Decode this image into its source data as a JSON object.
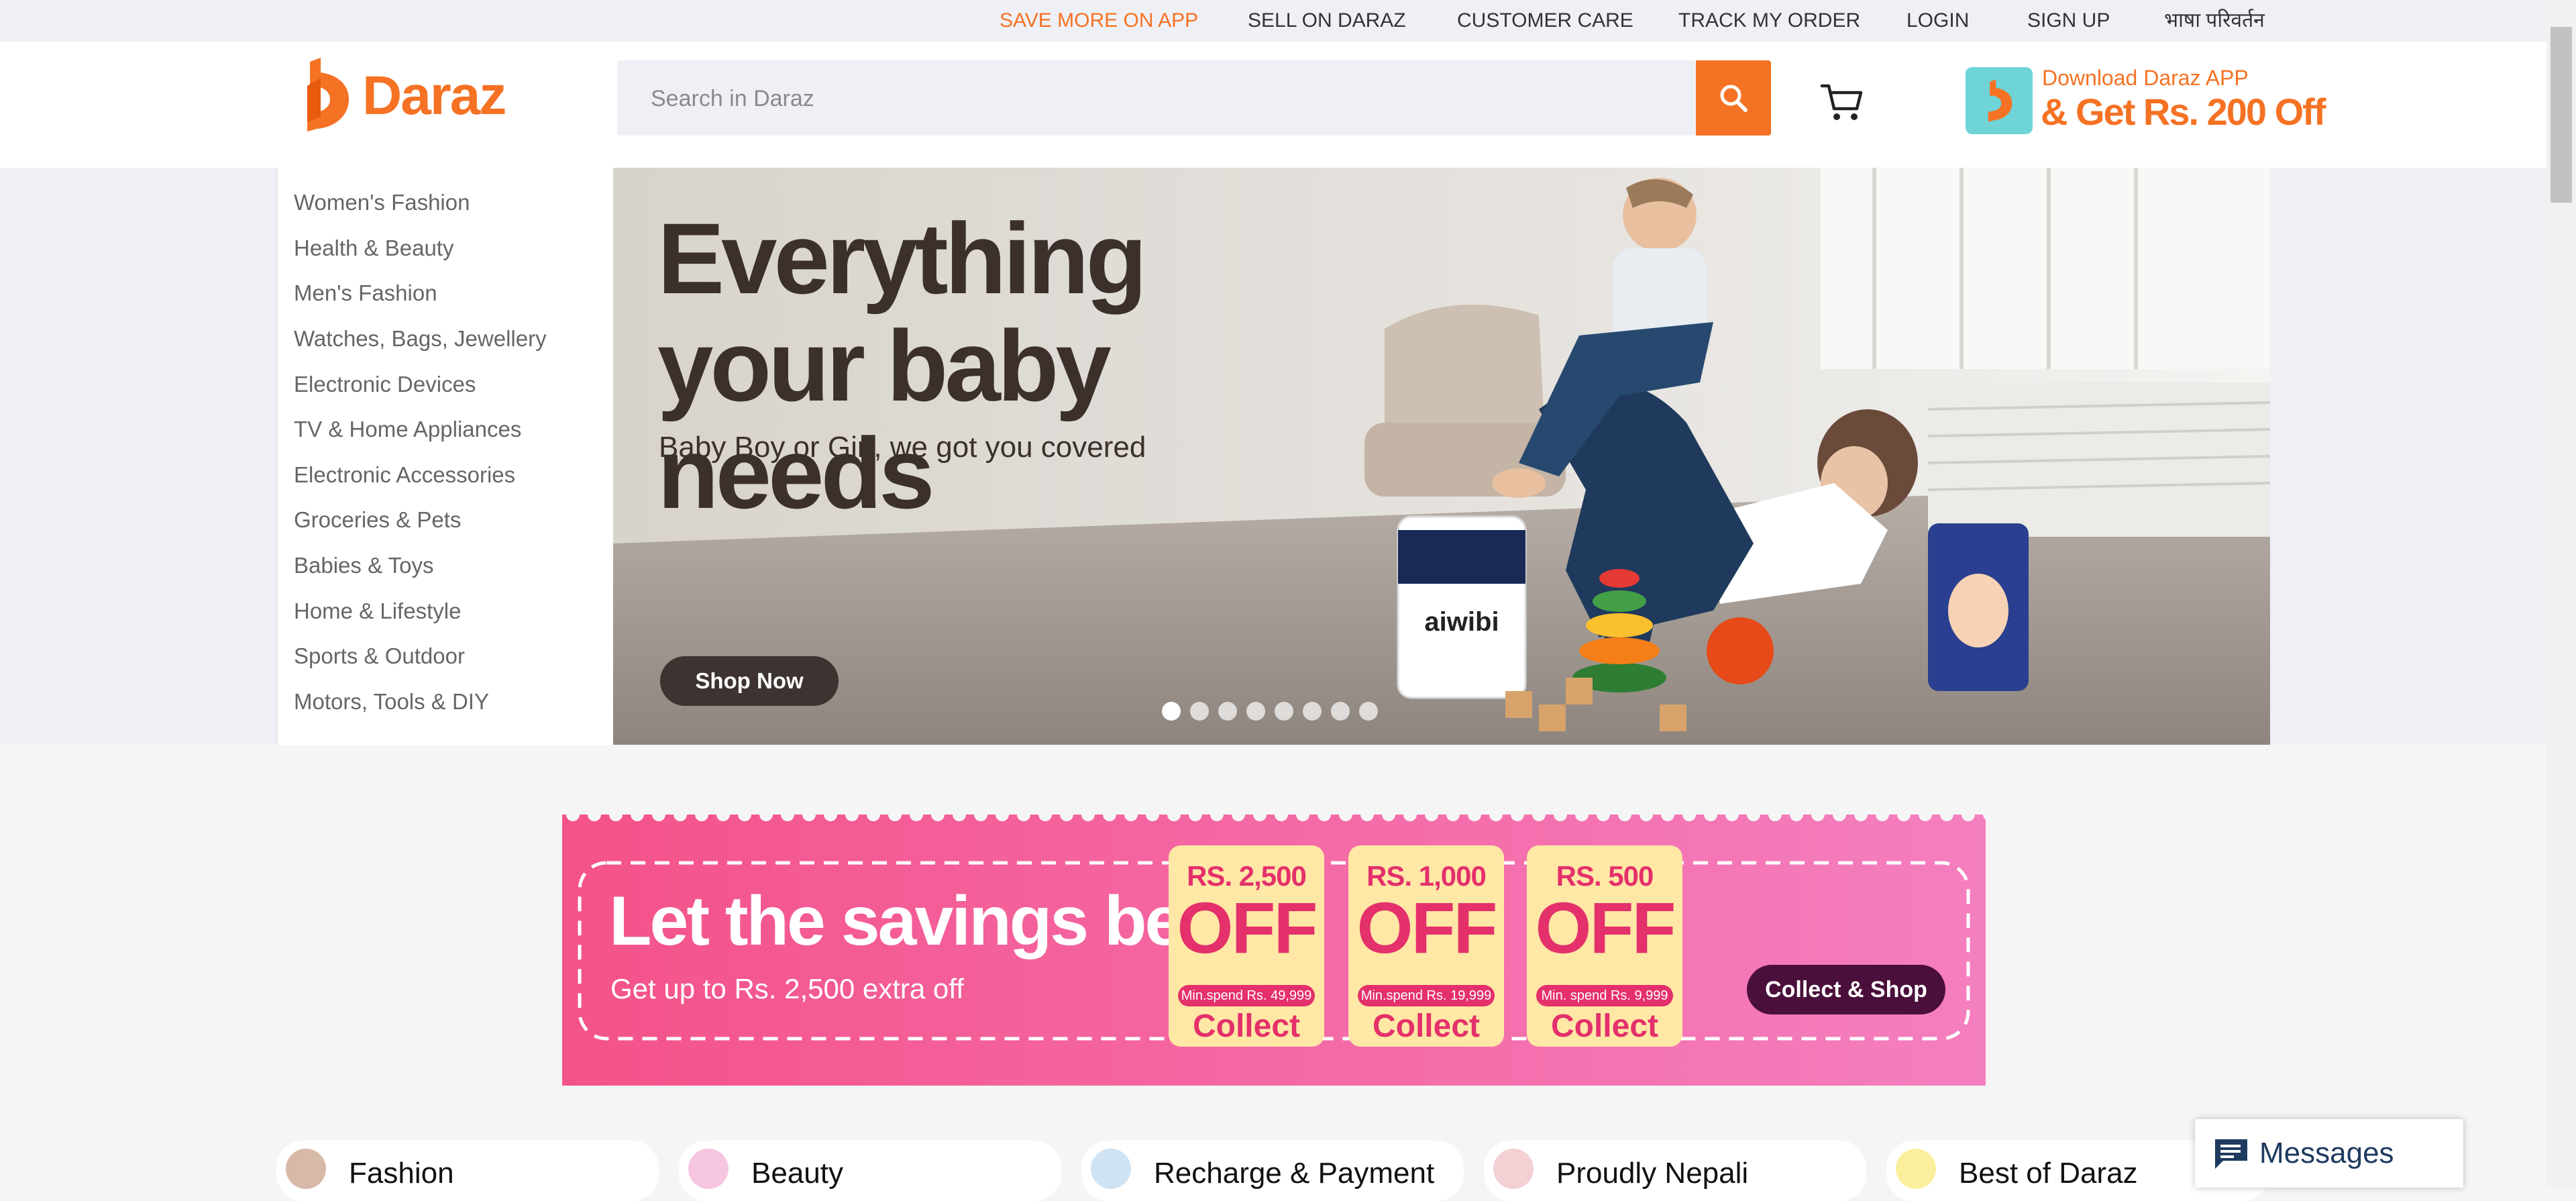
{
  "topbar": {
    "links": [
      "SAVE MORE ON APP",
      "SELL ON DARAZ",
      "CUSTOMER CARE",
      "TRACK MY ORDER",
      "LOGIN",
      "SIGN UP",
      "भाषा परिवर्तन"
    ]
  },
  "header": {
    "logo_text": "Daraz",
    "search_placeholder": "Search in Daraz",
    "search_value": "",
    "app_promo": {
      "line1": "Download Daraz APP",
      "line2": "& Get Rs. 200 Off"
    }
  },
  "categories": [
    "Women's Fashion",
    "Health & Beauty",
    "Men's Fashion",
    "Watches, Bags, Jewellery",
    "Electronic Devices",
    "TV & Home Appliances",
    "Electronic Accessories",
    "Groceries & Pets",
    "Babies & Toys",
    "Home & Lifestyle",
    "Sports & Outdoor",
    "Motors, Tools & DIY"
  ],
  "banner": {
    "title": "Everything your baby needs",
    "subtitle": "Baby Boy or Girl, we got you covered",
    "cta": "Shop Now",
    "product_label": "aiwibi",
    "slide_count": 8,
    "active_slide": 1
  },
  "promo": {
    "title": "Let the savings begin",
    "subtitle": "Get up to Rs. 2,500 extra off",
    "coupons": [
      {
        "amount": "RS. 2,500",
        "off": "OFF",
        "min": "Min.spend Rs. 49,999",
        "action": "Collect"
      },
      {
        "amount": "RS. 1,000",
        "off": "OFF",
        "min": "Min.spend Rs. 19,999",
        "action": "Collect"
      },
      {
        "amount": "RS. 500",
        "off": "OFF",
        "min": "Min. spend Rs. 9,999",
        "action": "Collect"
      }
    ],
    "cta": "Collect & Shop"
  },
  "tiles": [
    {
      "label": "Fashion",
      "icon": "fashion-icon"
    },
    {
      "label": "Beauty",
      "icon": "beauty-icon"
    },
    {
      "label": "Recharge & Payment",
      "icon": "recharge-icon"
    },
    {
      "label": "Proudly Nepali",
      "icon": "nepal-flag-icon"
    },
    {
      "label": "Best of Daraz",
      "icon": "star-icon"
    }
  ],
  "messages": {
    "label": "Messages"
  },
  "colors": {
    "accent": "#f57224",
    "promo_pink": "#f06aa0",
    "coupon_red": "#e4306b"
  }
}
